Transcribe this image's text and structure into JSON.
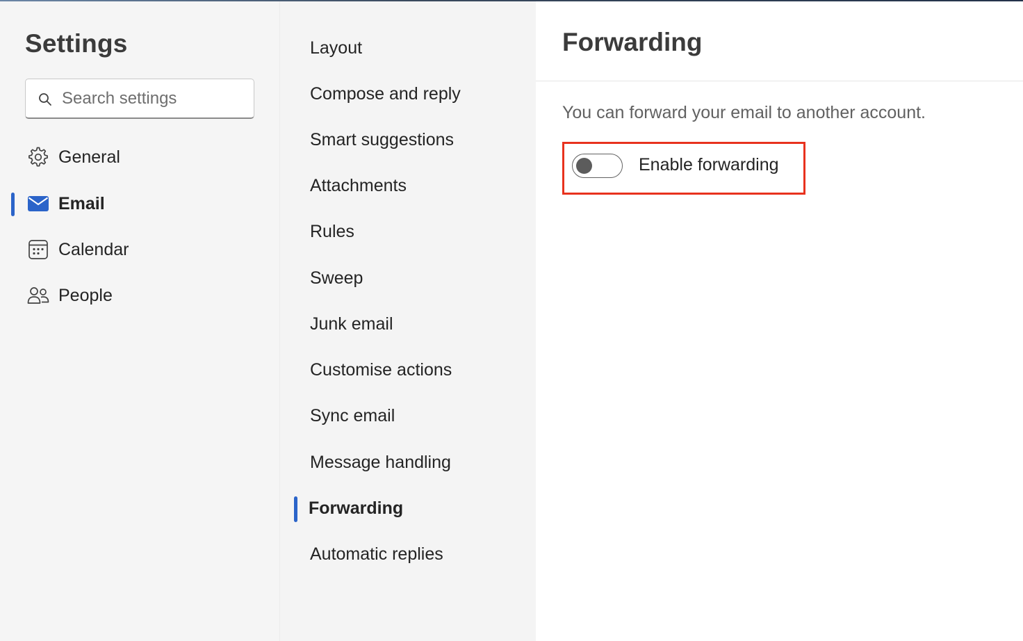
{
  "left": {
    "title": "Settings",
    "search": {
      "placeholder": "Search settings",
      "value": ""
    },
    "nav": [
      {
        "label": "General",
        "icon": "gear-icon",
        "active": false
      },
      {
        "label": "Email",
        "icon": "mail-icon",
        "active": true
      },
      {
        "label": "Calendar",
        "icon": "calendar-icon",
        "active": false
      },
      {
        "label": "People",
        "icon": "people-icon",
        "active": false
      }
    ]
  },
  "middle": {
    "items": [
      {
        "label": "Layout"
      },
      {
        "label": "Compose and reply"
      },
      {
        "label": "Smart suggestions"
      },
      {
        "label": "Attachments"
      },
      {
        "label": "Rules"
      },
      {
        "label": "Sweep"
      },
      {
        "label": "Junk email"
      },
      {
        "label": "Customise actions"
      },
      {
        "label": "Sync email"
      },
      {
        "label": "Message handling"
      },
      {
        "label": "Forwarding",
        "active": true
      },
      {
        "label": "Automatic replies"
      }
    ]
  },
  "right": {
    "title": "Forwarding",
    "description": "You can forward your email to another account.",
    "toggle": {
      "label": "Enable forwarding",
      "on": false
    }
  },
  "colors": {
    "accent": "#2b64c9",
    "highlight": "#e8321e",
    "mail_icon": "#2b64c9"
  }
}
